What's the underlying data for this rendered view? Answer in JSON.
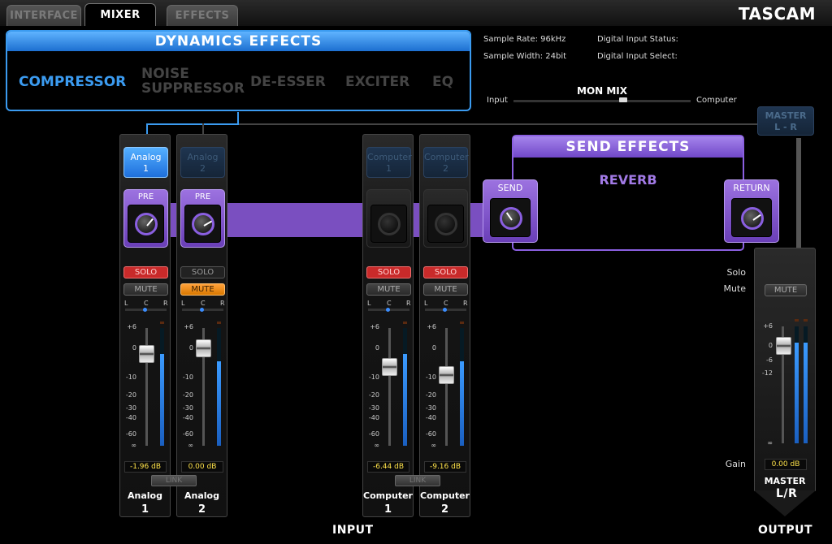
{
  "tabs": [
    {
      "label": "INTERFACE",
      "active": false
    },
    {
      "label": "MIXER",
      "active": true
    },
    {
      "label": "EFFECTS",
      "active": false
    }
  ],
  "brand": "TASCAM",
  "dynamics": {
    "title": "DYNAMICS EFFECTS",
    "items": [
      {
        "label": "COMPRESSOR",
        "active": true
      },
      {
        "label": "NOISE\nSUPPRESSOR",
        "active": false
      },
      {
        "label": "DE-ESSER",
        "active": false
      },
      {
        "label": "EXCITER",
        "active": false
      },
      {
        "label": "EQ",
        "active": false
      }
    ]
  },
  "info": {
    "sample_rate": "Sample Rate: 96kHz",
    "sample_width": "Sample Width: 24bit",
    "digital_status": "Digital Input Status:",
    "digital_select": "Digital Input Select:"
  },
  "mon_mix": {
    "title": "MON MIX",
    "left": "Input",
    "right": "Computer",
    "balance": 0.62
  },
  "channels": [
    {
      "top": "Analog",
      "topnum": "1",
      "on": true,
      "pre": "PRE",
      "pre_active": true,
      "knob_deg": 40,
      "solo": "SOLO",
      "solo_on": true,
      "mute": "MUTE",
      "mute_on": false,
      "pan": [
        "L",
        "C",
        "R"
      ],
      "fader_db": -1.96,
      "db_text": "-1.96 dB",
      "meter": [
        0.78,
        0.78
      ],
      "name": "Analog",
      "num": "1"
    },
    {
      "top": "Analog",
      "topnum": "2",
      "on": false,
      "pre": "PRE",
      "pre_active": true,
      "knob_deg": 60,
      "solo": "SOLO",
      "solo_on": false,
      "mute": "MUTE",
      "mute_on": true,
      "pan": [
        "L",
        "C",
        "R"
      ],
      "fader_db": 0.0,
      "db_text": "0.00 dB",
      "meter": [
        0.72,
        0.72
      ],
      "name": "Analog",
      "num": "2"
    },
    {
      "top": "Computer",
      "topnum": "1",
      "on": false,
      "pre": "",
      "pre_active": false,
      "knob_deg": 0,
      "solo": "SOLO",
      "solo_on": true,
      "mute": "MUTE",
      "mute_on": false,
      "pan": [
        "L",
        "C",
        "R"
      ],
      "fader_db": -6.44,
      "db_text": "-6.44 dB",
      "meter": [
        0.78,
        0.78
      ],
      "name": "Computer",
      "num": "1"
    },
    {
      "top": "Computer",
      "topnum": "2",
      "on": false,
      "pre": "",
      "pre_active": false,
      "knob_deg": 0,
      "solo": "SOLO",
      "solo_on": true,
      "mute": "MUTE",
      "mute_on": false,
      "pan": [
        "L",
        "C",
        "R"
      ],
      "fader_db": -9.16,
      "db_text": "-9.16 dB",
      "meter": [
        0.72,
        0.72
      ],
      "name": "Computer",
      "num": "2"
    }
  ],
  "scale": [
    "+6",
    "0",
    "-10",
    "-20",
    "-30",
    "-40",
    "-60",
    "∞"
  ],
  "link_label": "LINK",
  "send_effects": {
    "title": "SEND EFFECTS",
    "effect": "REVERB",
    "send": "SEND",
    "return": "RETURN",
    "send_deg": -35,
    "return_deg": 55
  },
  "master": {
    "top": "MASTER",
    "topsub": "L - R",
    "solo_label": "Solo",
    "mute_label": "Mute",
    "mute": "MUTE",
    "scale": [
      "+6",
      "0",
      "-6",
      "-12",
      "∞"
    ],
    "fader_db": 0.0,
    "db_text": "0.00 dB",
    "gain_label": "Gain",
    "meter": [
      0.86,
      0.86
    ],
    "name": "MASTER",
    "sub": "L/R"
  },
  "section_labels": {
    "input": "INPUT",
    "output": "OUTPUT"
  }
}
